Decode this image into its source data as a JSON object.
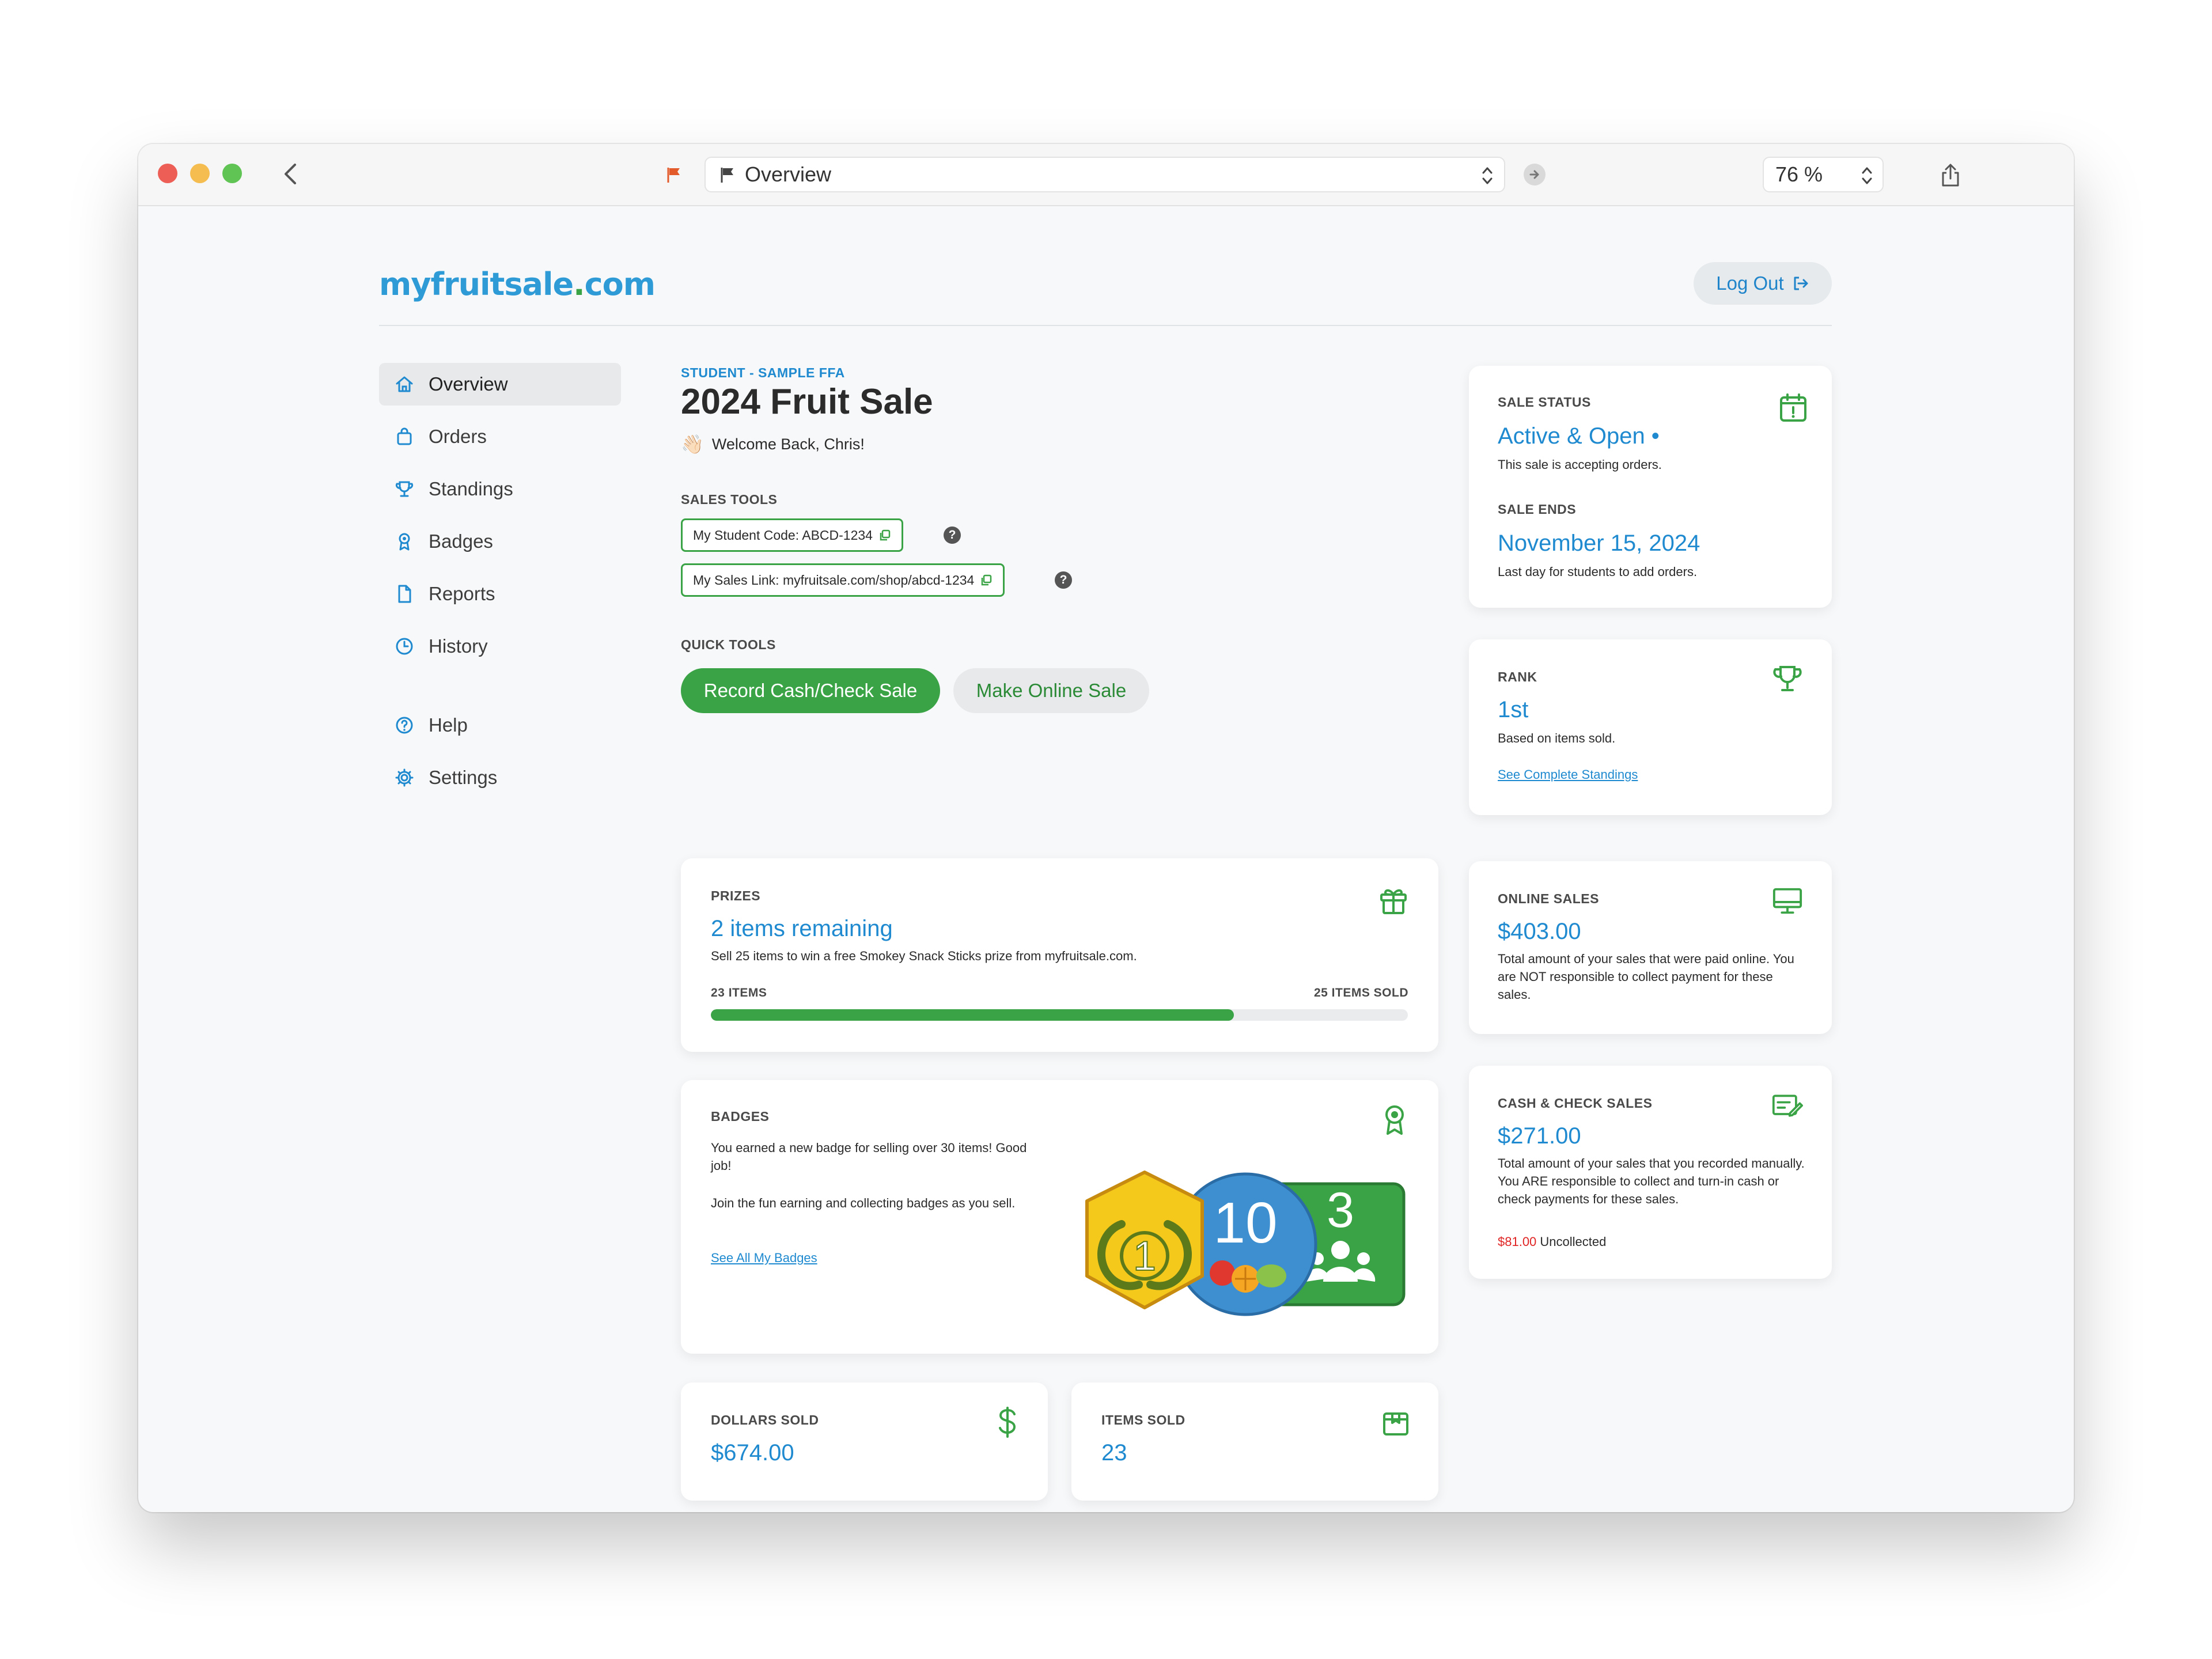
{
  "browser": {
    "url_title": "Overview",
    "zoom": "76 %"
  },
  "header": {
    "logo_main": "myfruitsale",
    "logo_dot": ".",
    "logo_tld": "com",
    "logout_label": "Log Out"
  },
  "nav": {
    "items": [
      {
        "label": "Overview",
        "icon": "home-icon",
        "active": true
      },
      {
        "label": "Orders",
        "icon": "shopping-bag-icon"
      },
      {
        "label": "Standings",
        "icon": "trophy-icon"
      },
      {
        "label": "Badges",
        "icon": "badge-icon"
      },
      {
        "label": "Reports",
        "icon": "document-icon"
      },
      {
        "label": "History",
        "icon": "clock-icon"
      },
      {
        "label": "Help",
        "icon": "help-circle-icon"
      },
      {
        "label": "Settings",
        "icon": "gear-icon"
      }
    ]
  },
  "main": {
    "student_label": "STUDENT - SAMPLE FFA",
    "sale_title": "2024 Fruit Sale",
    "welcome_emoji": "👋🏻",
    "welcome": "Welcome Back, Chris!",
    "sales_tools_label": "SALES TOOLS",
    "student_code": "My Student Code: ABCD-1234",
    "sales_link": "My Sales Link: myfruitsale.com/shop/abcd-1234",
    "help_mark": "?",
    "quick_tools_label": "QUICK TOOLS",
    "record_sale_label": "Record Cash/Check Sale",
    "online_sale_label": "Make Online Sale"
  },
  "sale_status": {
    "label": "SALE STATUS",
    "value": "Active & Open •",
    "text": "This sale is accepting orders.",
    "ends_label": "SALE ENDS",
    "ends_value": "November 15, 2024",
    "ends_text": "Last day for students to add orders."
  },
  "rank": {
    "label": "RANK",
    "value": "1st",
    "text": "Based on items sold.",
    "link": "See Complete Standings"
  },
  "prizes": {
    "label": "PRIZES",
    "value": "2 items remaining",
    "text": "Sell 25 items to win a free Smokey Snack Sticks prize from myfruitsale.com.",
    "left_label": "23 ITEMS",
    "right_label": "25 ITEMS SOLD",
    "progress": 0.75
  },
  "online_sales": {
    "label": "ONLINE SALES",
    "value": "$403.00",
    "text": "Total amount of your sales that were paid online. You are NOT responsible to collect payment for these sales."
  },
  "badges": {
    "label": "BADGES",
    "text1": "You earned a new badge for selling over 30 items! Good job!",
    "text2": "Join the fun earning and collecting badges as you sell.",
    "link": "See All My Badges",
    "badge_rank": "1",
    "badge_items": "10",
    "badge_team": "3"
  },
  "cash_sales": {
    "label": "CASH & CHECK SALES",
    "value": "$271.00",
    "text": "Total amount of your sales that you recorded manually. You ARE responsible to collect and turn-in cash or check payments for these sales.",
    "uncollected_amount": "$81.00",
    "uncollected_label": "Uncollected"
  },
  "dollars_sold": {
    "label": "DOLLARS SOLD",
    "value": "$674.00"
  },
  "items_sold": {
    "label": "ITEMS SOLD",
    "value": "23"
  },
  "colors": {
    "brand_blue": "#1f8acf",
    "brand_green": "#3aa346",
    "alert_red": "#e02424"
  }
}
